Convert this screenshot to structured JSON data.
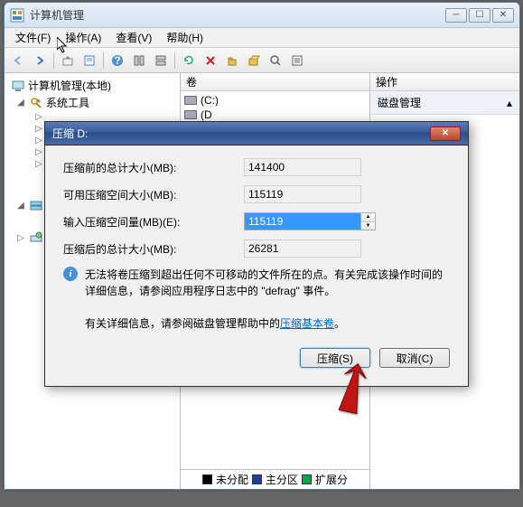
{
  "window": {
    "title": "计算机管理",
    "menu": {
      "file": "文件(F)",
      "action": "操作(A)",
      "view": "查看(V)",
      "help": "帮助(H)"
    }
  },
  "tree": {
    "root": "计算机管理(本地)",
    "systools": "系统工具"
  },
  "mid": {
    "header": "卷",
    "vol_c": "(C:)",
    "vol_d": "(D"
  },
  "right": {
    "header": "操作",
    "sub": "磁盘管理"
  },
  "legend": {
    "unalloc": "未分配",
    "primary": "主分区",
    "ext": "扩展分"
  },
  "dialog": {
    "title": "压缩 D:",
    "label_before": "压缩前的总计大小(MB):",
    "label_avail": "可用压缩空间大小(MB):",
    "label_input": "输入压缩空间量(MB)(E):",
    "label_after": "压缩后的总计大小(MB):",
    "val_before": "141400",
    "val_avail": "115119",
    "val_input": "115119",
    "val_after": "26281",
    "info1": "无法将卷压缩到超出任何不可移动的文件所在的点。有关完成该操作时间的详细信息，请参阅应用程序日志中的 \"defrag\" 事件。",
    "info2_pre": "有关详细信息，请参阅磁盘管理帮助中的",
    "info2_link": "压缩基本卷",
    "info2_post": "。",
    "btn_shrink": "压缩(S)",
    "btn_cancel": "取消(C)"
  }
}
